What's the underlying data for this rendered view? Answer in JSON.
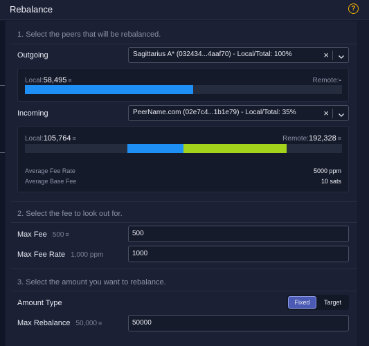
{
  "header": {
    "title": "Rebalance",
    "help_icon": "?"
  },
  "section1": {
    "title": "1. Select the peers that will be rebalanced.",
    "outgoing": {
      "label": "Outgoing",
      "selected": "Sagittarius A* (032434...4aaf70) - Local/Total: 100%",
      "local_label": "Local:",
      "local_value": "58,495",
      "remote_label": "Remote:",
      "remote_value": "-",
      "local_fraction": 0.53
    },
    "incoming": {
      "label": "Incoming",
      "selected": "PeerName.com (02e7c4...1b1e79) - Local/Total: 35%",
      "local_label": "Local:",
      "local_value": "105,764",
      "remote_label": "Remote:",
      "remote_value": "192,328",
      "average_fee_rate_label": "Average Fee Rate",
      "average_fee_rate_value": "5000 ppm",
      "average_base_fee_label": "Average Base Fee",
      "average_base_fee_value": "10 sats",
      "local_share": 0.35
    }
  },
  "section2": {
    "title": "2. Select the fee to look out for.",
    "max_fee_label": "Max Fee",
    "max_fee_sub": "500",
    "max_fee_value": "500",
    "max_fee_rate_label": "Max Fee Rate",
    "max_fee_rate_sub": "1,000 ppm",
    "max_fee_rate_value": "1000"
  },
  "section3": {
    "title": "3. Select the amount you want to rebalance.",
    "amount_type_label": "Amount Type",
    "options": [
      "Fixed",
      "Target"
    ],
    "selected_option": "Fixed",
    "max_rebalance_label": "Max Rebalance",
    "max_rebalance_sub": "50,000",
    "max_rebalance_value": "50000"
  },
  "colors": {
    "local_bar": "#1e90f5",
    "remote_bar": "#a3d41b",
    "accent": "#f2b300",
    "toggle_active": "#4b5bb5"
  },
  "icons": {
    "sats": "sats-symbol-icon",
    "clear": "close-icon",
    "dropdown": "chevron-down-icon",
    "help": "help-icon"
  }
}
